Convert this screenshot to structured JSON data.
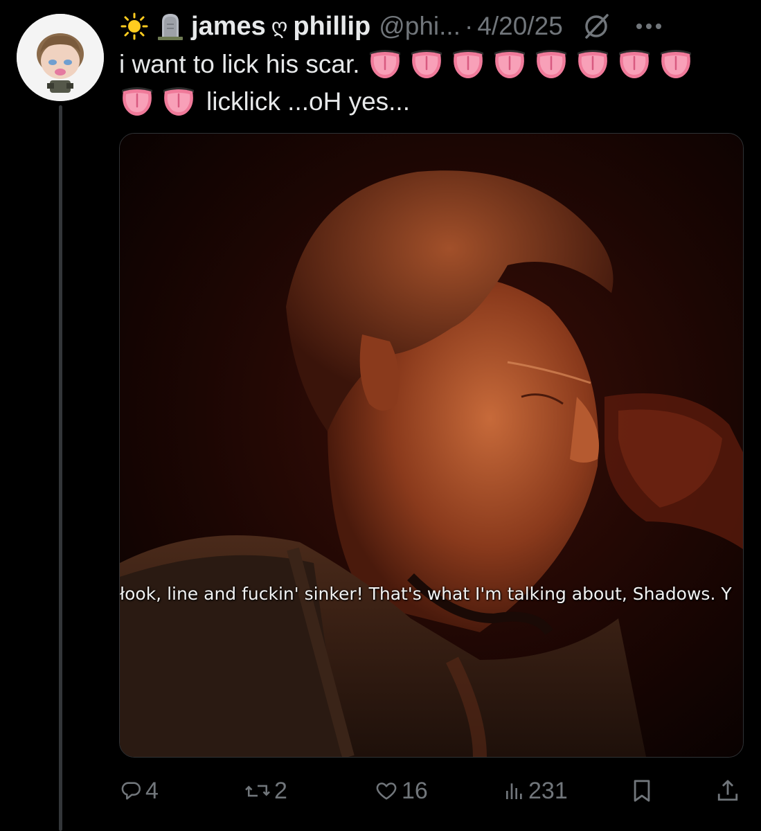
{
  "post": {
    "display_name_part1": "james",
    "display_name_heart": "ღ",
    "display_name_part2": "phillip",
    "handle": "@phi...",
    "separator": "·",
    "date": "4/20/25",
    "text_line1": "i want to lick his scar.",
    "text_line2": "licklick ...oH  yes...",
    "emoji_line1_count": 8,
    "emoji_line2_count": 2
  },
  "media": {
    "subtitle": "łook, line and fuckin' sinker! That's what I'm talking about, Shadows. Y"
  },
  "actions": {
    "replies": "4",
    "reposts": "2",
    "likes": "16",
    "views": "231"
  },
  "icons": {
    "sun": "sun-icon",
    "headstone": "headstone-icon",
    "grok": "grok-icon",
    "more": "more-icon",
    "reply": "reply-icon",
    "repost": "repost-icon",
    "like": "heart-icon",
    "views": "views-icon",
    "bookmark": "bookmark-icon",
    "share": "share-icon"
  },
  "colors": {
    "background": "#000000",
    "text": "#e7e9ea",
    "muted": "#71767b"
  }
}
